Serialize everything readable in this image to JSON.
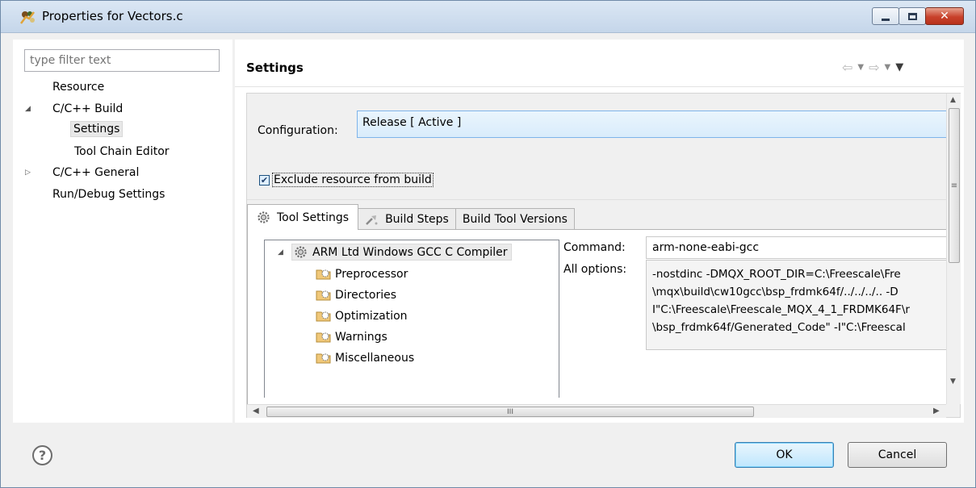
{
  "window": {
    "title": "Properties for Vectors.c"
  },
  "left_pane": {
    "filter_placeholder": "type filter text",
    "tree": [
      {
        "label": "Resource",
        "level": 0,
        "arrow": ""
      },
      {
        "label": "C/C++ Build",
        "level": 0,
        "arrow": "expanded"
      },
      {
        "label": "Settings",
        "level": 1,
        "arrow": "",
        "selected": true
      },
      {
        "label": "Tool Chain Editor",
        "level": 1,
        "arrow": ""
      },
      {
        "label": "C/C++ General",
        "level": 0,
        "arrow": "collapsed"
      },
      {
        "label": "Run/Debug Settings",
        "level": 0,
        "arrow": ""
      }
    ]
  },
  "right_pane": {
    "title": "Settings",
    "configuration_label": "Configuration:",
    "configuration_value": "Release  [ Active ]",
    "exclude_label": "Exclude resource from build",
    "exclude_checked": true,
    "tabs": [
      {
        "label": "Tool Settings",
        "icon": "gear-icon",
        "active": true
      },
      {
        "label": "Build Steps",
        "icon": "build-steps-icon",
        "active": false
      },
      {
        "label": "Build Tool Versions",
        "icon": "",
        "active": false
      }
    ],
    "tool_tree": {
      "root": "ARM Ltd Windows GCC C Compiler",
      "children": [
        "Preprocessor",
        "Directories",
        "Optimization",
        "Warnings",
        "Miscellaneous"
      ]
    },
    "command_label": "Command:",
    "command_value": "arm-none-eabi-gcc",
    "all_options_label": "All options:",
    "all_options_lines": [
      "-nostdinc -DMQX_ROOT_DIR=C:\\Freescale\\Fre",
      "\\mqx\\build\\cw10gcc\\bsp_frdmk64f/../../../.. -D",
      "I\"C:\\Freescale\\Freescale_MQX_4_1_FRDMK64F\\r",
      "\\bsp_frdmk64f/Generated_Code\" -I\"C:\\Freescal"
    ],
    "h_scroll_grip": "III",
    "v_scroll_grip": "≡"
  },
  "footer": {
    "help_glyph": "?",
    "ok_label": "OK",
    "cancel_label": "Cancel"
  },
  "colors": {
    "selection_accent": "#7eb4ea",
    "close_button": "#c8412b"
  }
}
